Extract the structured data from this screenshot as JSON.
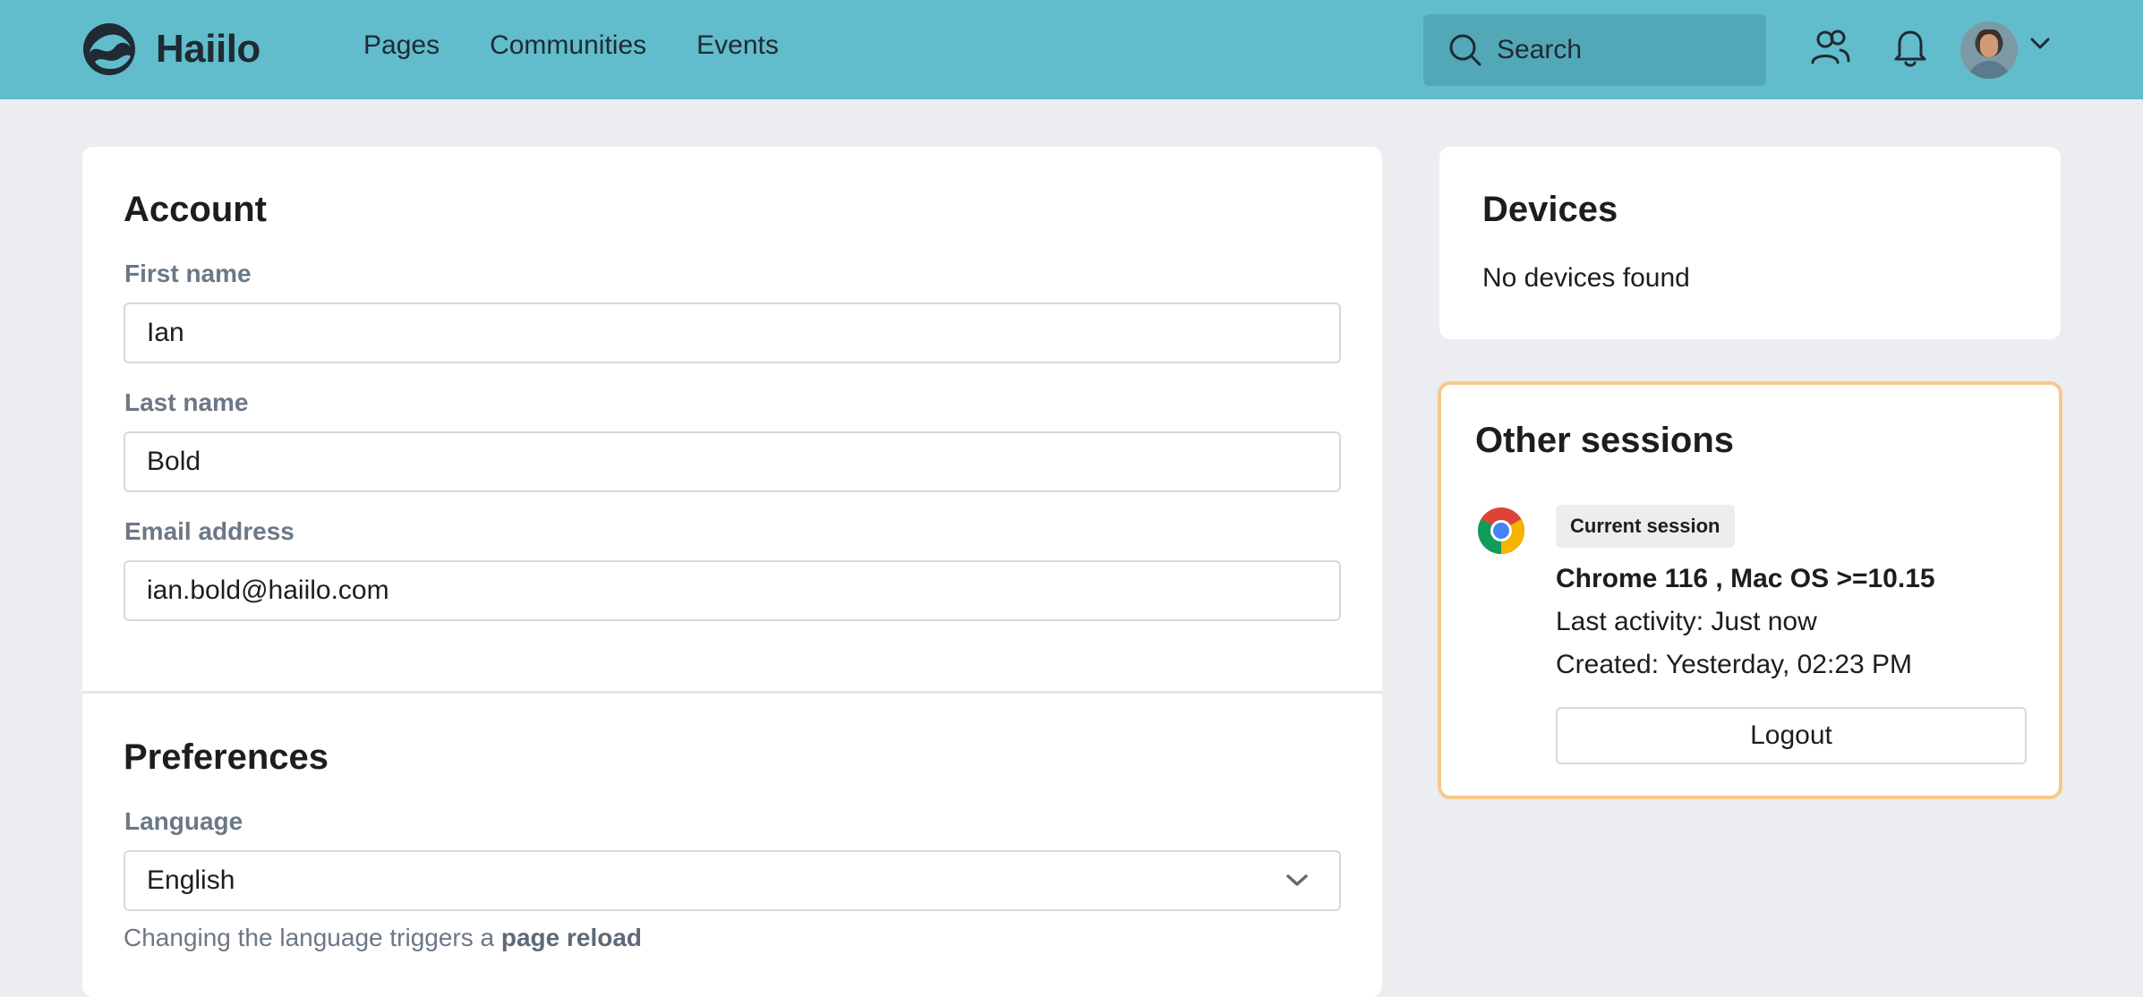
{
  "header": {
    "brand": "Haiilo",
    "nav": [
      "Pages",
      "Communities",
      "Events"
    ],
    "search_placeholder": "Search",
    "colors": {
      "bar": "#61bccb",
      "search_bg": "#53a8b8"
    },
    "icons": [
      "search-icon",
      "people-icon",
      "bell-icon",
      "chevron-down-icon"
    ]
  },
  "account": {
    "title": "Account",
    "first_name_label": "First name",
    "first_name_value": "Ian",
    "last_name_label": "Last name",
    "last_name_value": "Bold",
    "email_label": "Email address",
    "email_value": "ian.bold@haiilo.com"
  },
  "preferences": {
    "title": "Preferences",
    "language_label": "Language",
    "language_value": "English",
    "hint_prefix": "Changing the language triggers a ",
    "hint_bold": "page reload"
  },
  "devices": {
    "title": "Devices",
    "empty_text": "No devices found"
  },
  "sessions": {
    "title": "Other sessions",
    "badge": "Current session",
    "browser": "Chrome 116 , Mac OS >=10.15",
    "last_activity": "Last activity: Just now",
    "created": "Created: Yesterday, 02:23 PM",
    "logout_label": "Logout",
    "highlight_color": "#f5c98a"
  }
}
